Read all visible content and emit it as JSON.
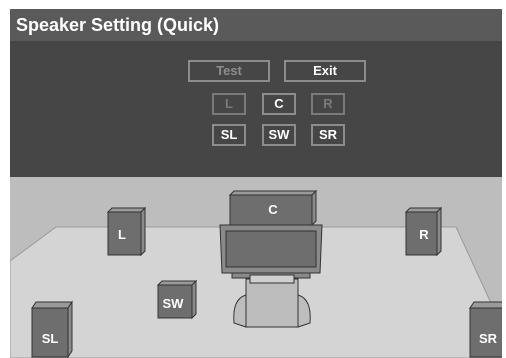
{
  "title": "Speaker Setting (Quick)",
  "buttons": {
    "test": "Test",
    "exit": "Exit"
  },
  "channels": {
    "row1": [
      "L",
      "C",
      "R"
    ],
    "row2": [
      "SL",
      "SW",
      "SR"
    ]
  },
  "speakers": {
    "front_left": "L",
    "center": "C",
    "front_right": "R",
    "subwoofer": "SW",
    "surround_left": "SL",
    "surround_right": "SR"
  },
  "colors": {
    "title_bar": "#5a5a5a",
    "menu_bg": "#464646",
    "room_bg": "#bdbdbd",
    "floor": "#d4d4d4",
    "speaker": "#6e6e6e"
  }
}
